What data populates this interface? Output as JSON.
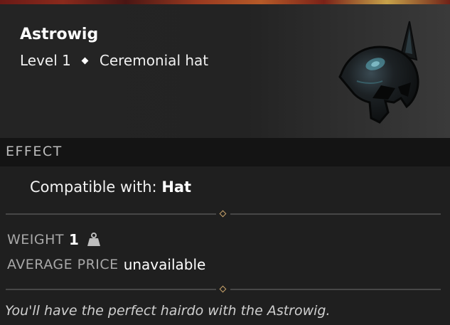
{
  "item": {
    "name": "Astrowig",
    "level": "Level 1",
    "type": "Ceremonial hat"
  },
  "effect": {
    "section_title": "EFFECT",
    "compatible_label": "Compatible with:",
    "compatible_value": "Hat"
  },
  "stats": {
    "weight_label": "WEIGHT",
    "weight_value": "1",
    "price_label": "AVERAGE PRICE",
    "price_value": "unavailable"
  },
  "flavor_text": "You'll have the perfect hairdo with the Astrowig.",
  "colors": {
    "accent_gold": "#c9a36a",
    "background": "#1f1f1f"
  },
  "icons": {
    "item_image": "helmet-icon",
    "weight": "weight-icon"
  }
}
